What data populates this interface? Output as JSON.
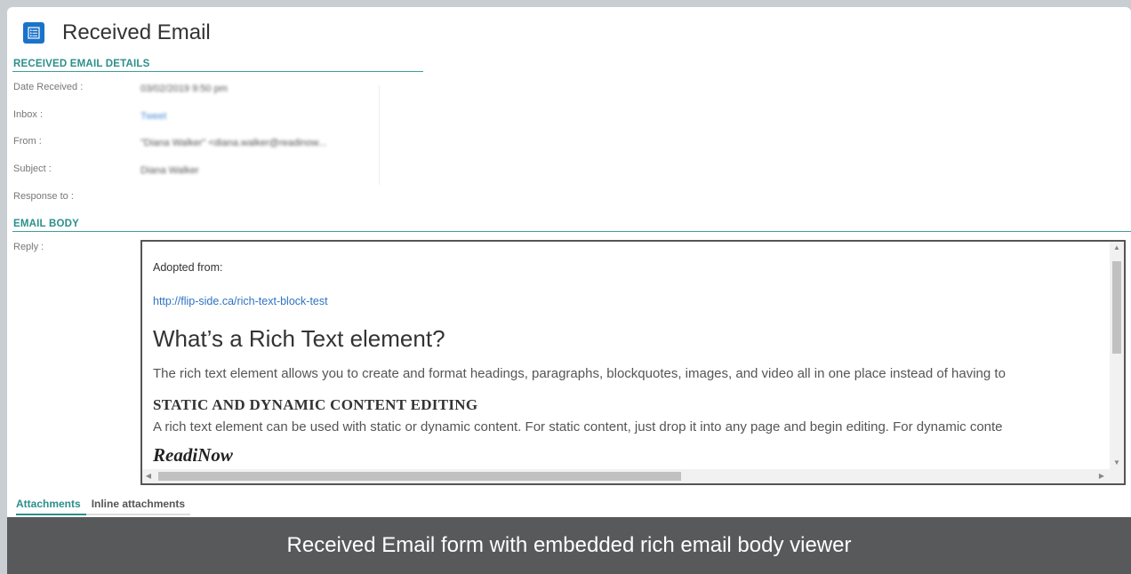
{
  "window": {
    "title": "Received Email"
  },
  "details": {
    "section_title": "RECEIVED EMAIL DETAILS",
    "fields": [
      {
        "label": "Date Received :",
        "value": "03/02/2019 9:50 pm"
      },
      {
        "label": "Inbox :",
        "value": "Tweet"
      },
      {
        "label": "From :",
        "value": "\"Diana Walker\" <diana.walker@readinow..."
      },
      {
        "label": "Subject :",
        "value": "Diana Walker"
      },
      {
        "label": "Response to :",
        "value": ""
      }
    ]
  },
  "body": {
    "section_title": "EMAIL BODY",
    "reply_label": "Reply :",
    "adopted_text": "Adopted from:",
    "url": "http://flip-side.ca/rich-text-block-test",
    "heading": "What’s a Rich Text element?",
    "paragraph1": "The rich text element allows you to create and format headings, paragraphs, blockquotes, images, and video all in one place instead of having to",
    "subheading": "STATIC AND DYNAMIC CONTENT EDITING",
    "paragraph2": "A rich text element can be used with static or dynamic content. For static content, just drop it into any page and begin editing. For dynamic conte",
    "brand": "ReadiNow",
    "scroll_up_arrow": "▲",
    "scroll_down_arrow": "▼",
    "scroll_left_arrow": "◀",
    "scroll_right_arrow": "▶"
  },
  "tabs": [
    {
      "label": "Attachments",
      "active": true
    },
    {
      "label": "Inline attachments",
      "active": false
    }
  ],
  "caption": "Received Email form with embedded rich email body viewer",
  "colors": {
    "accent": "#2b8f8c",
    "icon": "#1a73c9",
    "caption_bg": "#58595b"
  }
}
